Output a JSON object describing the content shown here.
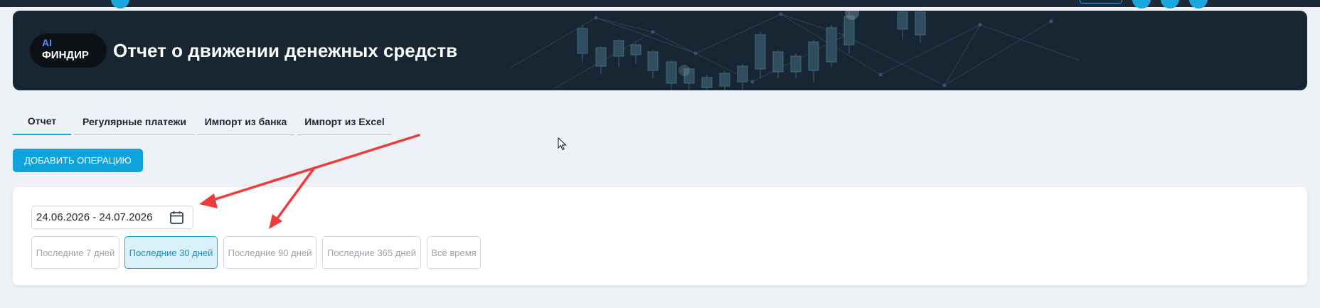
{
  "header": {
    "logo_ai": "AI",
    "logo_name": "ФИНДИР",
    "title": "Отчет о движении денежных средств"
  },
  "tabs": [
    {
      "label": "Отчет",
      "active": true
    },
    {
      "label": "Регулярные платежи",
      "active": false
    },
    {
      "label": "Импорт из банка",
      "active": false
    },
    {
      "label": "Импорт из Excel",
      "active": false
    }
  ],
  "add_button": {
    "label": "ДОБАВИТЬ ОПЕРАЦИЮ"
  },
  "filter": {
    "date_range": "24.06.2026 - 24.07.2026",
    "periods": [
      {
        "label": "Последние 7 дней",
        "active": false
      },
      {
        "label": "Последние 30 дней",
        "active": true
      },
      {
        "label": "Последние 90 дней",
        "active": false
      },
      {
        "label": "Последние 365 дней",
        "active": false
      },
      {
        "label": "Всё время",
        "active": false
      }
    ]
  },
  "colors": {
    "accent": "#1ca6de",
    "banner_bg": "#172632",
    "annotation_arrow": "#ee3b3b"
  },
  "icons": [
    "calendar-icon",
    "mouse-cursor-icon",
    "annotation-arrow-icon"
  ]
}
